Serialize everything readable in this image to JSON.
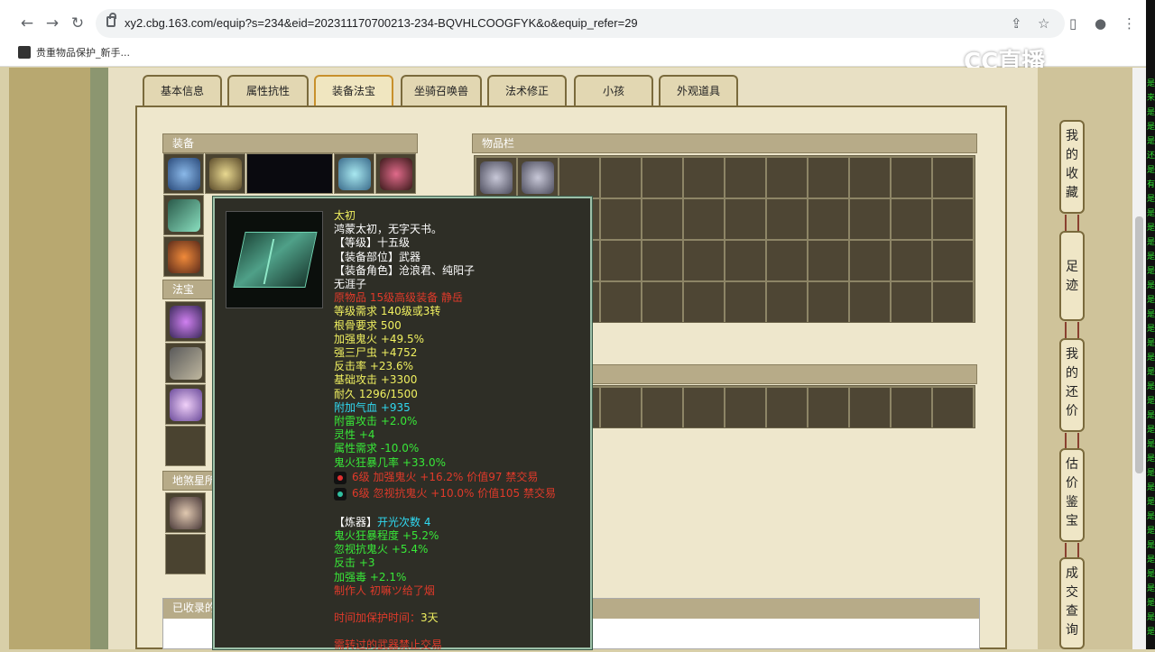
{
  "browser": {
    "url": "xy2.cbg.163.com/equip?s=234&eid=202311170700213-234-BQVHLCOOGFYK&o&equip_refer=29",
    "bookmark_label": "贵重物品保护_新手..."
  },
  "logo_text": "CC直播",
  "tabs": [
    "基本信息",
    "属性抗性",
    "装备法宝",
    "坐骑召唤兽",
    "法术修正",
    "小孩",
    "外观道具"
  ],
  "sections": {
    "equipment": "装备",
    "fabao": "法宝",
    "disha": "地煞星所",
    "inventory": "物品栏",
    "collected": "已收录的"
  },
  "tooltip": {
    "name": "太初",
    "desc": "鸿蒙太初，无字天书。",
    "grade": "【等级】十五级",
    "slot": "【装备部位】武器",
    "roles": "【装备角色】沧浪君、纯阳子",
    "maker_title": "无涯子",
    "origin": "原物品 15级高级装备 静岳",
    "level_req": "等级需求 140级或3转",
    "root_req": "根骨要求 500",
    "stats": [
      "加强鬼火 +49.5%",
      "强三尸虫 +4752",
      "反击率 +23.6%",
      "基础攻击 +3300",
      "耐久 1296/1500"
    ],
    "extra_cyan": "附加气血 +935",
    "extra_green": [
      "附雷攻击 +2.0%",
      "灵性 +4",
      "属性需求 -10.0%",
      "鬼火狂暴几率 +33.0%"
    ],
    "gems": [
      {
        "text": "6级 加强鬼火 +16.2% 价值97 禁交易",
        "color": "#e03030"
      },
      {
        "text": "6级 忽视抗鬼火 +10.0% 价值105 禁交易",
        "color": "#30c0a0"
      }
    ],
    "refine_label": "【炼器】",
    "refine_count": "开光次数 4",
    "refine_stats": [
      "鬼火狂暴程度 +5.2%",
      "忽视抗鬼火 +5.4%",
      "反击 +3",
      "加强毒 +2.1%"
    ],
    "made_by": "制作人 初嘛ツ给了烟",
    "protect_label": "时间加保护时间：",
    "protect_value": "3天",
    "warning": "需转过的武器禁止交易"
  },
  "side_buttons": [
    "我的收藏",
    "足迹",
    "我的还价",
    "估价鉴宝",
    "成交查询"
  ],
  "colors": {
    "tooltip_bg": "#2e2e26",
    "yellow": "#f0f060",
    "red": "#e03a2a",
    "green": "#38e838",
    "cyan": "#30d8f0"
  }
}
